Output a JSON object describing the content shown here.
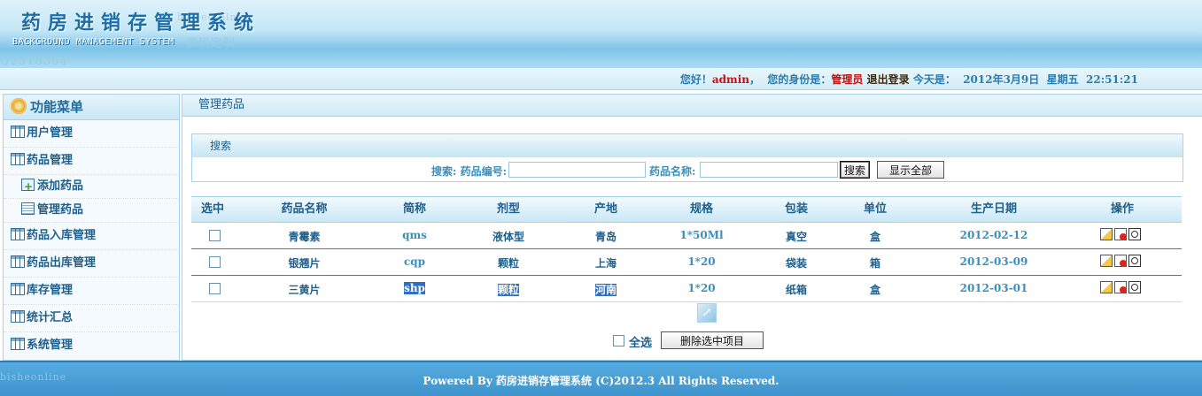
{
  "header": {
    "title": "药房进销存管理系统",
    "subtitle": "BACKGROUND MANAGEMENT SYSTEM"
  },
  "watermark": {
    "a": "bisheonline",
    "b": "源码定制",
    "c": "Q2518364"
  },
  "infobar": {
    "greeting": "您好！",
    "username": "admin",
    "comma": "，",
    "role_label": "您的身份是：",
    "role": "管理员",
    "logout": "退出登录",
    "today_label": "今天是：",
    "date": "2012年3月9日",
    "weekday": "星期五",
    "time": "22:51:21"
  },
  "sidebar": {
    "title": "功能菜单",
    "items": [
      {
        "label": "用户管理"
      },
      {
        "label": "药品管理"
      },
      {
        "label": "添加药品"
      },
      {
        "label": "管理药品"
      },
      {
        "label": "药品入库管理"
      },
      {
        "label": "药品出库管理"
      },
      {
        "label": "库存管理"
      },
      {
        "label": "统计汇总"
      },
      {
        "label": "系统管理"
      }
    ]
  },
  "main": {
    "title": "管理药品",
    "search": {
      "section_title": "搜索",
      "code_label": "搜索: 药品编号:",
      "code_value": "",
      "name_label": "药品名称:",
      "name_value": "",
      "search_button": "搜索",
      "show_all_button": "显示全部"
    },
    "table": {
      "headers": [
        "选中",
        "药品名称",
        "简称",
        "剂型",
        "产地",
        "规格",
        "包装",
        "单位",
        "生产日期",
        "操作"
      ],
      "rows": [
        {
          "name": "青霉素",
          "short": "qms",
          "form": "液体型",
          "origin": "青岛",
          "spec": "1*50Ml",
          "pack": "真空",
          "unit": "盒",
          "date": "2012-02-12"
        },
        {
          "name": "银翘片",
          "short": "cqp",
          "form": "颗粒",
          "origin": "上海",
          "spec": "1*20",
          "pack": "袋装",
          "unit": "箱",
          "date": "2012-03-09"
        },
        {
          "name": "三黄片",
          "short": "shp",
          "form": "颗粒",
          "origin": "河南",
          "spec": "1*20",
          "pack": "纸箱",
          "unit": "盒",
          "date": "2012-03-01"
        }
      ]
    },
    "select_all": "全选",
    "delete_selected": "删除选中项目"
  },
  "footer": {
    "text": "Powered By 药房进销存管理系统 (C)2012.3 All Rights Reserved."
  },
  "colors": {
    "header_blue": "#7dc4e8",
    "text_blue": "#1f5f8b",
    "accent_red": "#c01010",
    "footer_blue": "#4a9fd6"
  }
}
